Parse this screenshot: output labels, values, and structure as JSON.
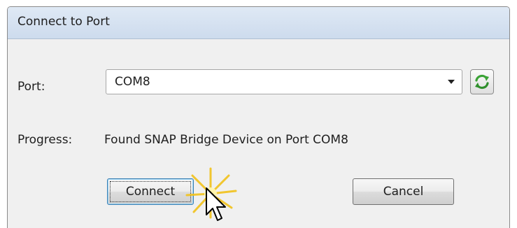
{
  "window": {
    "title": "Connect to Port"
  },
  "port": {
    "label": "Port:",
    "selected_value": "COM8",
    "refresh_icon": "refresh-icon"
  },
  "progress": {
    "label": "Progress:",
    "message": "Found SNAP Bridge Device on Port COM8"
  },
  "buttons": {
    "connect_label": "Connect",
    "cancel_label": "Cancel"
  },
  "colors": {
    "titlebar": "#dfe9f5",
    "dialog_background": "#f0f0f0",
    "focus_border": "#3c7fb1",
    "refresh_icon": "#3aa335"
  }
}
